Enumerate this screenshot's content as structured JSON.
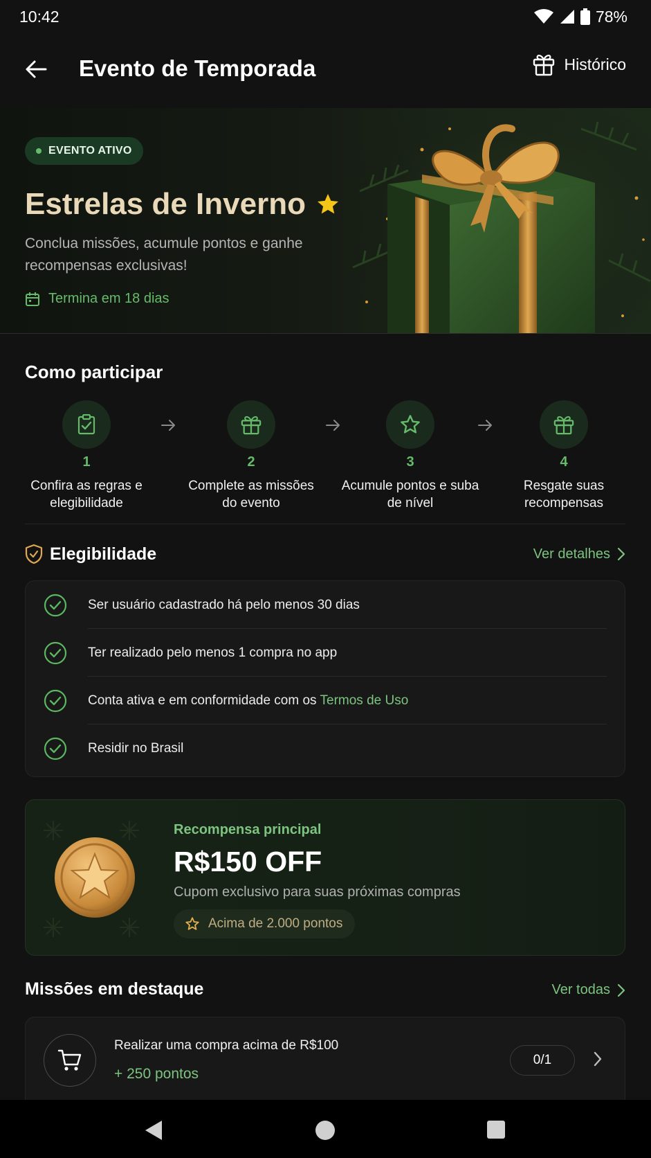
{
  "status_bar": {
    "time": "10:42",
    "battery": "78%"
  },
  "app_bar": {
    "title": "Evento de Temporada",
    "history_label": "Histórico"
  },
  "hero": {
    "badge": "EVENTO ATIVO",
    "title": "Estrelas de Inverno",
    "description": "Conclua missões, acumule pontos e ganhe recompensas exclusivas!",
    "deadline": "Termina em 18 dias"
  },
  "how_to": {
    "title": "Como participar",
    "steps": [
      {
        "number": "1",
        "label": "Confira as regras e elegibilidade",
        "icon": "clipboard-check-icon"
      },
      {
        "number": "2",
        "label": "Complete as missões do evento",
        "icon": "gift-icon"
      },
      {
        "number": "3",
        "label": "Acumule pontos e suba de nível",
        "icon": "star-icon"
      },
      {
        "number": "4",
        "label": "Resgate suas recompensas",
        "icon": "gift-icon"
      }
    ]
  },
  "eligibility": {
    "title": "Elegibilidade",
    "details_link": "Ver detalhes",
    "items": [
      {
        "text": "Ser usuário cadastrado há pelo menos 30 dias"
      },
      {
        "text": "Ter realizado pelo menos 1 compra no app"
      },
      {
        "text": "Conta ativa e em conformidade com os ",
        "link": "Termos de Uso"
      },
      {
        "text": "Residir no Brasil"
      }
    ]
  },
  "reward": {
    "kicker": "Recompensa principal",
    "amount": "R$150 OFF",
    "description": "Cupom exclusivo para suas próximas compras",
    "requirement": "Acima de 2.000 pontos"
  },
  "missions": {
    "title": "Missões em destaque",
    "see_all": "Ver todas",
    "items": [
      {
        "title": "Realizar uma compra acima de R$100",
        "points": "+ 250 pontos",
        "progress": "0/1",
        "icon": "cart-icon"
      }
    ]
  },
  "colors": {
    "accent_green": "#7cc47f",
    "gold": "#ead9b8",
    "background": "#121212"
  }
}
